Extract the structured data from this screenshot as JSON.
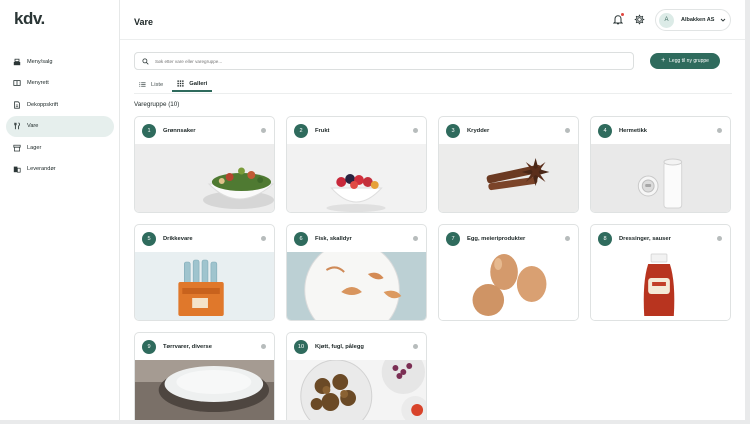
{
  "app": {
    "logo": "kdv."
  },
  "sidebar": {
    "items": [
      {
        "label": "Meny/salg",
        "icon": "register-icon"
      },
      {
        "label": "Menyrett",
        "icon": "menu-dish-icon"
      },
      {
        "label": "Dekoppskrift",
        "icon": "recipe-doc-icon"
      },
      {
        "label": "Vare",
        "icon": "utensils-icon",
        "active": true
      },
      {
        "label": "Lager",
        "icon": "archive-box-icon"
      },
      {
        "label": "Leverandør",
        "icon": "building-icon"
      }
    ]
  },
  "header": {
    "title": "Vare",
    "account": {
      "initial": "A",
      "name": "Albakken AS"
    }
  },
  "search": {
    "placeholder": "Søk etter vare eller varegruppe..."
  },
  "actions": {
    "add_group": "Legg til ny gruppe"
  },
  "tabs": [
    {
      "label": "Liste",
      "active": false
    },
    {
      "label": "Galleri",
      "active": true
    }
  ],
  "section": {
    "title": "Varegruppe (10)"
  },
  "groups": [
    {
      "number": "1",
      "name": "Grønnsaker",
      "image": "salad"
    },
    {
      "number": "2",
      "name": "Frukt",
      "image": "fruit-bowl"
    },
    {
      "number": "3",
      "name": "Krydder",
      "image": "spices"
    },
    {
      "number": "4",
      "name": "Hermetikk",
      "image": "cans"
    },
    {
      "number": "5",
      "name": "Drikkevare",
      "image": "drinks-crate"
    },
    {
      "number": "6",
      "name": "Fisk, skalldyr",
      "image": "shrimp-plate"
    },
    {
      "number": "7",
      "name": "Egg, meieriprodukter",
      "image": "eggs"
    },
    {
      "number": "8",
      "name": "Dressinger, sauser",
      "image": "ketchup"
    },
    {
      "number": "9",
      "name": "Tørrvarer, diverse",
      "image": "salt-bowl"
    },
    {
      "number": "10",
      "name": "Kjøtt, fugl, pålegg",
      "image": "meat-bowl"
    }
  ],
  "colors": {
    "accent": "#2f6b5d",
    "active_nav_bg": "#e6efed",
    "notification": "#e0463f"
  }
}
